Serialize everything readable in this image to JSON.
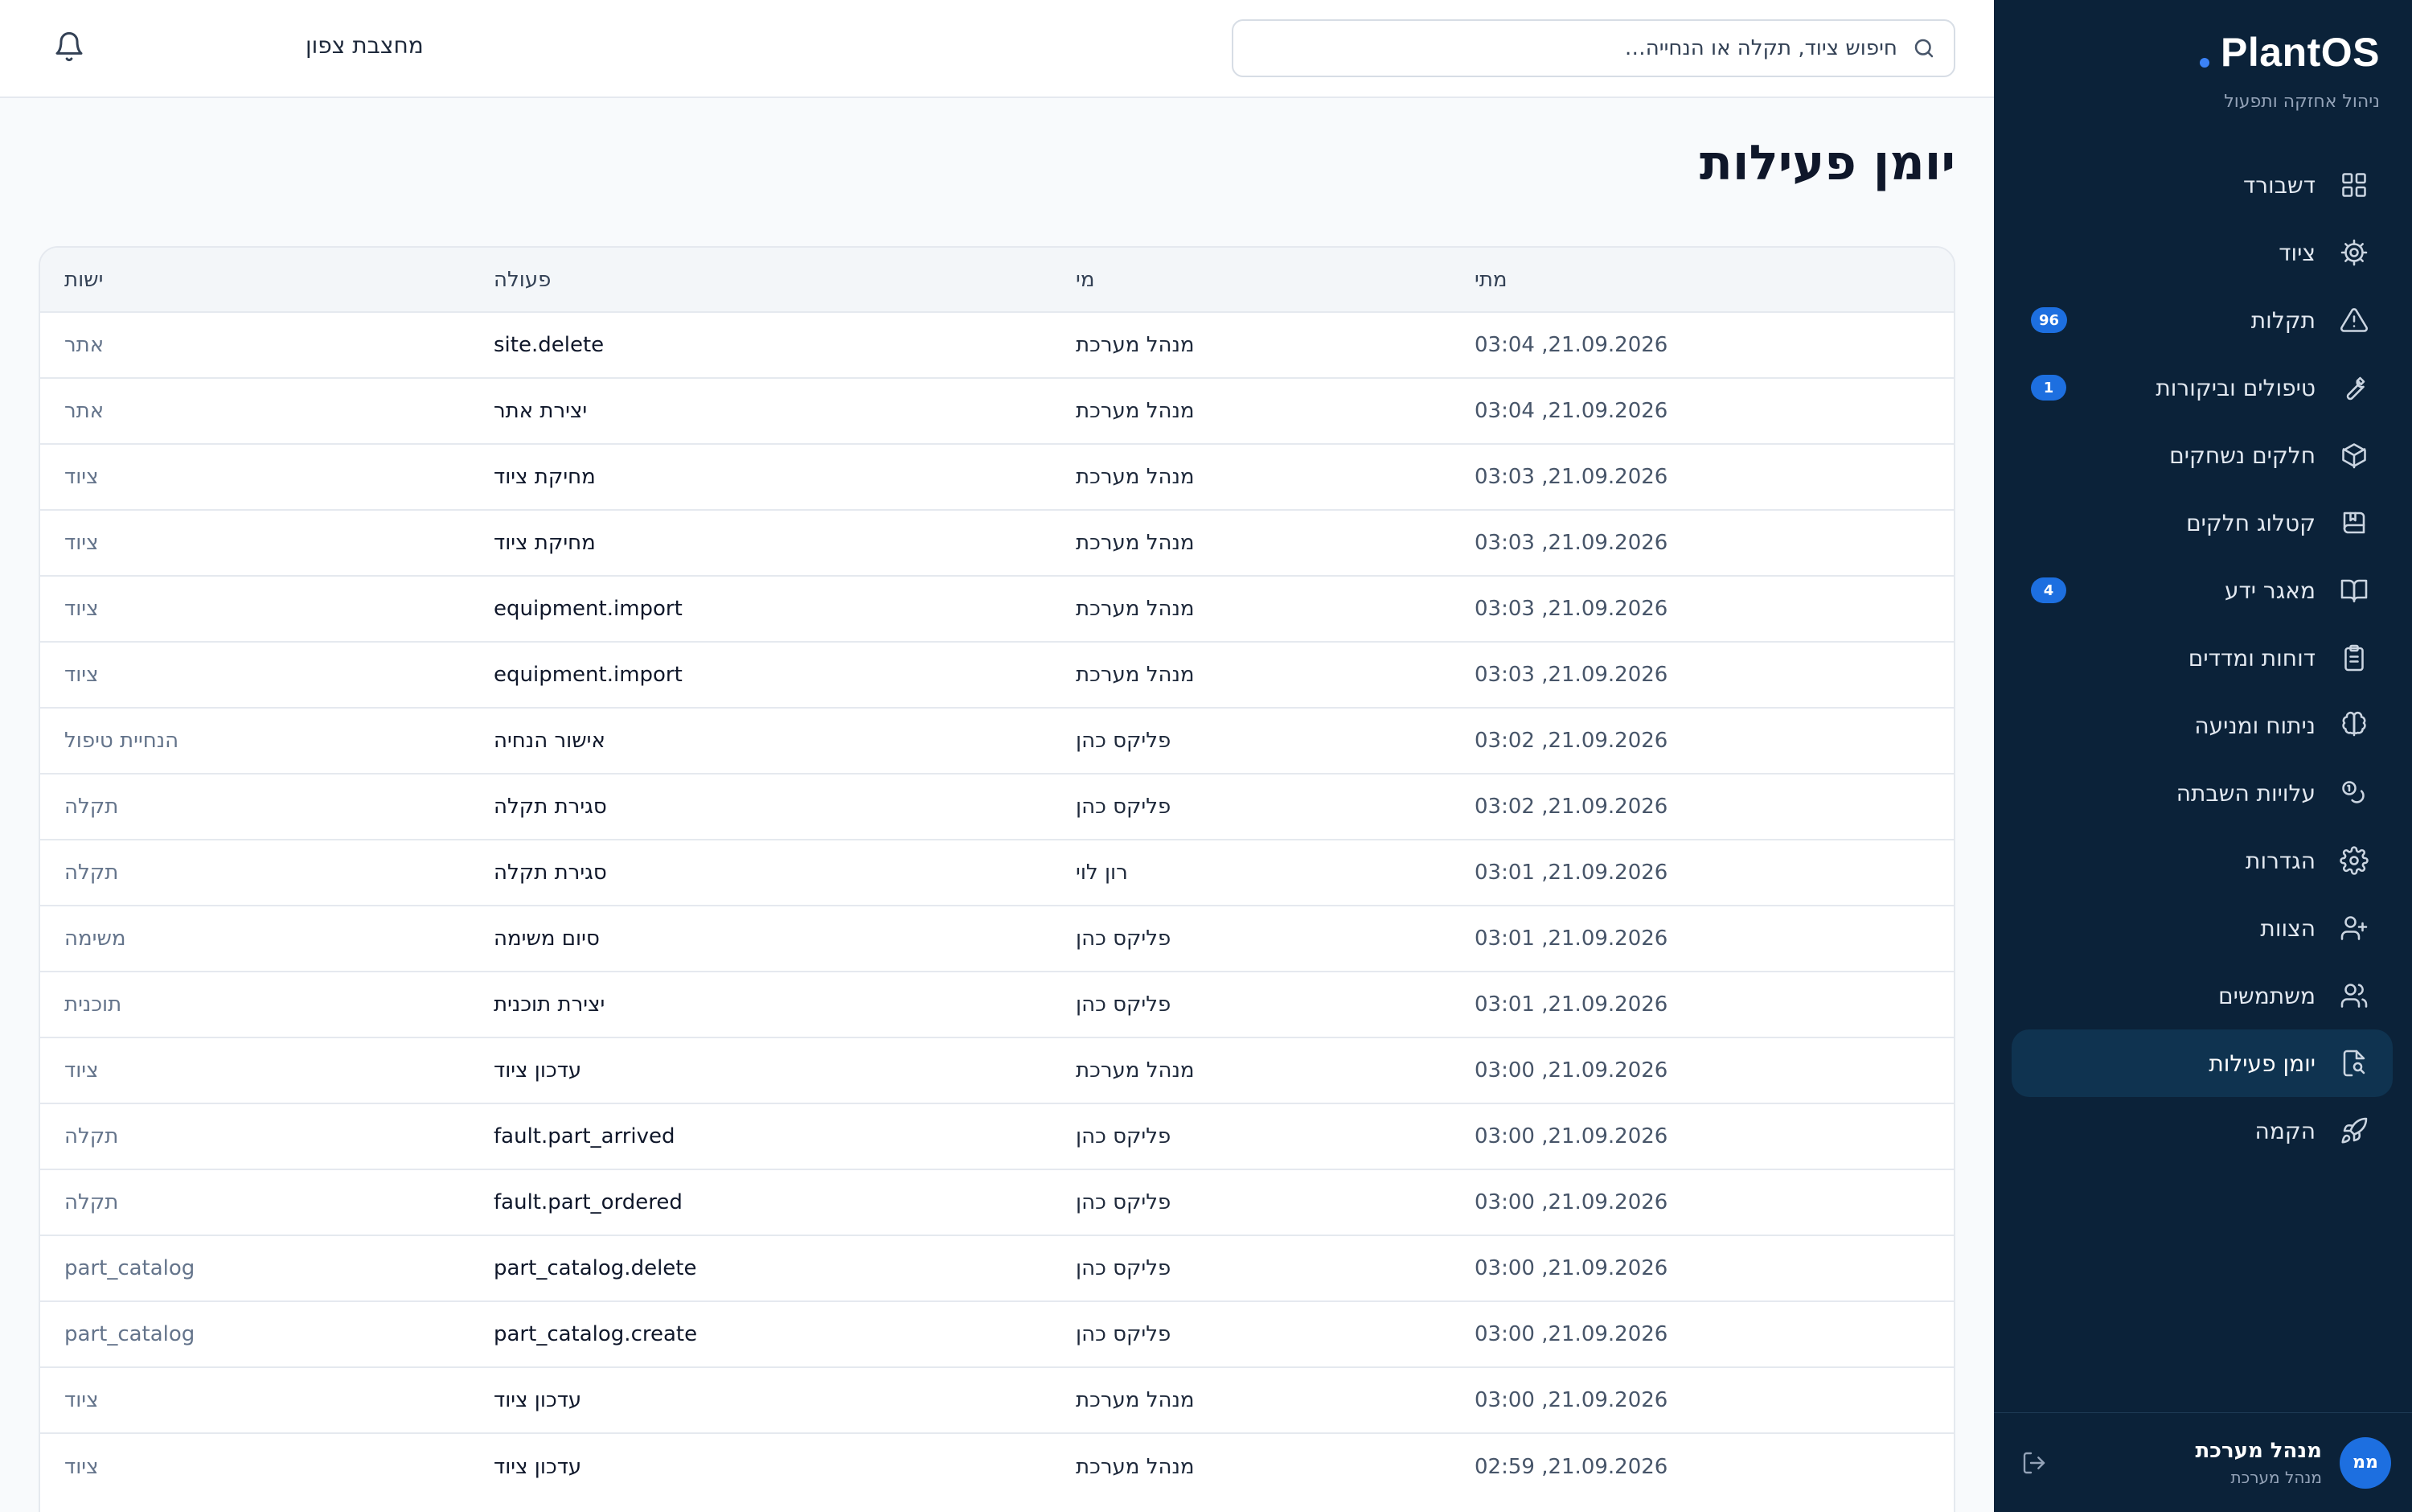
{
  "sidebar": {
    "brand": "PlantOS",
    "subtitle": "ניהול אחזקה ותפעול",
    "items": [
      {
        "label": "דשבורד",
        "icon": "dashboard-grid-icon"
      },
      {
        "label": "ציוד",
        "icon": "gear-icon"
      },
      {
        "label": "תקלות",
        "icon": "warning-icon",
        "badge": "96"
      },
      {
        "label": "טיפולים וביקורות",
        "icon": "wrench-icon",
        "badge": "1"
      },
      {
        "label": "חלקים נשחקים",
        "icon": "package-icon"
      },
      {
        "label": "קטלוג חלקים",
        "icon": "catalog-book-icon"
      },
      {
        "label": "מאגר ידע",
        "icon": "open-book-icon",
        "badge": "4"
      },
      {
        "label": "דוחות ומדדים",
        "icon": "clipboard-icon"
      },
      {
        "label": "ניתוח ומניעה",
        "icon": "brain-icon"
      },
      {
        "label": "עלויות השבתה",
        "icon": "coins-icon"
      },
      {
        "label": "הגדרות",
        "icon": "settings-cog-icon"
      },
      {
        "label": "הצוות",
        "icon": "user-icon"
      },
      {
        "label": "משתמשים",
        "icon": "users-icon"
      },
      {
        "label": "יומן פעילות",
        "icon": "file-search-icon",
        "active": true
      },
      {
        "label": "הקמה",
        "icon": "rocket-icon"
      }
    ],
    "user": {
      "initials": "ממ",
      "name": "מנהל מערכת",
      "role": "מנהל מערכת"
    }
  },
  "topbar": {
    "search_placeholder": "חיפוש ציוד, תקלה או הנחייה…",
    "site_name": "מחצבת צפון"
  },
  "main": {
    "title": "יומן פעילות",
    "columns": [
      "מתי",
      "מי",
      "פעולה",
      "ישות"
    ],
    "rows": [
      [
        "21.09.2026, 03:04",
        "מנהל מערכת",
        "site.delete",
        "אתר"
      ],
      [
        "21.09.2026, 03:04",
        "מנהל מערכת",
        "יצירת אתר",
        "אתר"
      ],
      [
        "21.09.2026, 03:03",
        "מנהל מערכת",
        "מחיקת ציוד",
        "ציוד"
      ],
      [
        "21.09.2026, 03:03",
        "מנהל מערכת",
        "מחיקת ציוד",
        "ציוד"
      ],
      [
        "21.09.2026, 03:03",
        "מנהל מערכת",
        "equipment.import",
        "ציוד"
      ],
      [
        "21.09.2026, 03:03",
        "מנהל מערכת",
        "equipment.import",
        "ציוד"
      ],
      [
        "21.09.2026, 03:02",
        "פליקס כהן",
        "אישור הנחיה",
        "הנחיית טיפול"
      ],
      [
        "21.09.2026, 03:02",
        "פליקס כהן",
        "סגירת תקלה",
        "תקלה"
      ],
      [
        "21.09.2026, 03:01",
        "רון לוי",
        "סגירת תקלה",
        "תקלה"
      ],
      [
        "21.09.2026, 03:01",
        "פליקס כהן",
        "סיום משימה",
        "משימה"
      ],
      [
        "21.09.2026, 03:01",
        "פליקס כהן",
        "יצירת תוכנית",
        "תוכנית"
      ],
      [
        "21.09.2026, 03:00",
        "מנהל מערכת",
        "עדכון ציוד",
        "ציוד"
      ],
      [
        "21.09.2026, 03:00",
        "פליקס כהן",
        "fault.part_arrived",
        "תקלה"
      ],
      [
        "21.09.2026, 03:00",
        "פליקס כהן",
        "fault.part_ordered",
        "תקלה"
      ],
      [
        "21.09.2026, 03:00",
        "פליקס כהן",
        "part_catalog.delete",
        "part_catalog"
      ],
      [
        "21.09.2026, 03:00",
        "פליקס כהן",
        "part_catalog.create",
        "part_catalog"
      ],
      [
        "21.09.2026, 03:00",
        "מנהל מערכת",
        "עדכון ציוד",
        "ציוד"
      ],
      [
        "21.09.2026, 02:59",
        "מנהל מערכת",
        "עדכון ציוד",
        "ציוד"
      ]
    ]
  },
  "colors": {
    "sidebar_bg": "#0b2239",
    "accent": "#1d6fe0",
    "active_item_bg": "#0f3350"
  }
}
